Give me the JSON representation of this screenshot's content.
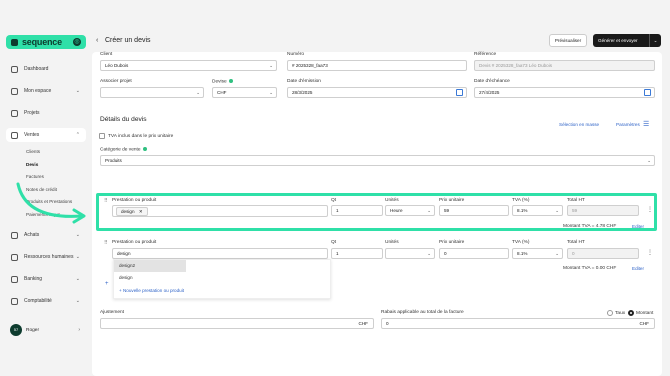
{
  "brand": {
    "name": "sequence",
    "colors": {
      "accent": "#2fe0a8",
      "dark": "#0d3b2e",
      "link": "#2f63c7"
    }
  },
  "sidebar": {
    "items": [
      {
        "label": "Dashboard",
        "icon": "dashboard-icon"
      },
      {
        "label": "Mon espace",
        "icon": "user-icon"
      },
      {
        "label": "Projets",
        "icon": "projects-icon"
      },
      {
        "label": "Ventes",
        "icon": "sales-icon"
      },
      {
        "label": "Achats",
        "icon": "cart-icon"
      },
      {
        "label": "Ressources humaines",
        "icon": "people-icon"
      },
      {
        "label": "Banking",
        "icon": "bank-icon"
      },
      {
        "label": "Comptabilité",
        "icon": "accounting-icon"
      }
    ],
    "sales_sub": [
      "Clients",
      "Devis",
      "Factures",
      "Notes de crédit",
      "Produits et Prestations",
      "Paiements reçus"
    ],
    "user": {
      "initials": "57",
      "name": "Roger"
    }
  },
  "header": {
    "title": "Créer un devis",
    "preview_label": "Prévisualiser",
    "generate_label": "Générer et envoyer"
  },
  "form": {
    "client_label": "Client",
    "client_value": "Léo Dubois",
    "number_label": "Numéro",
    "number_value": "# 2025328_faa73",
    "reference_label": "Référence",
    "reference_value": "Devis # 2025328_faa73 Léo Dubois",
    "project_label": "Associer projet",
    "project_value": "",
    "currency_label": "Devise",
    "currency_value": "CHF",
    "issue_label": "Date d'émission",
    "issue_value": "28/3/2025",
    "due_label": "Date d'échéance",
    "due_value": "27/4/2025"
  },
  "details": {
    "title": "Détails du devis",
    "bulk_label": "Sélection en masse",
    "settings_label": "Paramètres",
    "vat_included_label": "TVA inclus dans le prix unitaire",
    "category_label": "Catégorie de vente",
    "category_value": "Produits",
    "columns": [
      "Prestation ou produit",
      "Qt",
      "Unités",
      "Prix unitaire",
      "TVA (%)",
      "Total HT"
    ],
    "lines": [
      {
        "product": "design",
        "qty": "1",
        "unit": "Heure",
        "price": "59",
        "vat": "8.1%",
        "total": "59",
        "vat_amount": "Montant TVA = 4.78 CHF",
        "edit": "Editer"
      },
      {
        "product": "design",
        "qty": "1",
        "unit": "",
        "price": "0",
        "vat": "8.1%",
        "total": "0",
        "vat_amount": "Montant TVA = 0.00 CHF",
        "edit": "Editer"
      }
    ],
    "dropdown_options": [
      "design2",
      "design"
    ],
    "new_option_label": "Nouvelle prestation ou produit"
  },
  "footer": {
    "adjust_label": "Ajustement",
    "adjust_currency": "CHF",
    "discount_label": "Rabais applicable au total de la facture",
    "discount_value": "0",
    "discount_currency": "CHF",
    "radio_rate": "Taux",
    "radio_amount": "Montant"
  }
}
